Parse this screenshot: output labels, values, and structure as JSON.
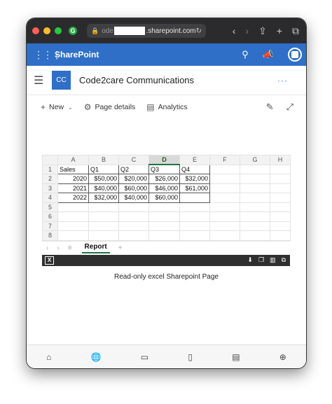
{
  "browser": {
    "url_prefix": "ode",
    "url_suffix": ".sharepoint.com"
  },
  "sharepoint": {
    "app_name": "SharePoint",
    "site_logo": "CC",
    "site_name": "Code2care Communications",
    "more": "···"
  },
  "commands": {
    "new": "New",
    "page_details": "Page details",
    "analytics": "Analytics"
  },
  "sheet": {
    "columns": [
      "A",
      "B",
      "C",
      "D",
      "E",
      "F",
      "G",
      "H"
    ],
    "selected_column": "D",
    "rows": [
      {
        "num": "1",
        "cells": [
          "Sales",
          "Q1",
          "Q2",
          "Q3",
          "Q4",
          "",
          "",
          ""
        ]
      },
      {
        "num": "2",
        "cells": [
          "2020",
          "$50,000",
          "$20,000",
          "$26,000",
          "$32,000",
          "",
          "",
          ""
        ]
      },
      {
        "num": "3",
        "cells": [
          "2021",
          "$40,000",
          "$60,000",
          "$46,000",
          "$61,000",
          "",
          "",
          ""
        ]
      },
      {
        "num": "4",
        "cells": [
          "2022",
          "$32,000",
          "$40,000",
          "$60,000",
          "",
          "",
          "",
          ""
        ]
      },
      {
        "num": "5",
        "cells": [
          "",
          "",
          "",
          "",
          "",
          "",
          "",
          ""
        ]
      },
      {
        "num": "6",
        "cells": [
          "",
          "",
          "",
          "",
          "",
          "",
          "",
          ""
        ]
      },
      {
        "num": "7",
        "cells": [
          "",
          "",
          "",
          "",
          "",
          "",
          "",
          ""
        ]
      },
      {
        "num": "8",
        "cells": [
          "",
          "",
          "",
          "",
          "",
          "",
          "",
          ""
        ]
      }
    ],
    "tab_name": "Report",
    "add_tab": "+"
  },
  "caption": "Read-only excel Sharepoint Page",
  "colors": {
    "sharepoint_blue": "#2f6fc7",
    "excel_green": "#217346"
  }
}
